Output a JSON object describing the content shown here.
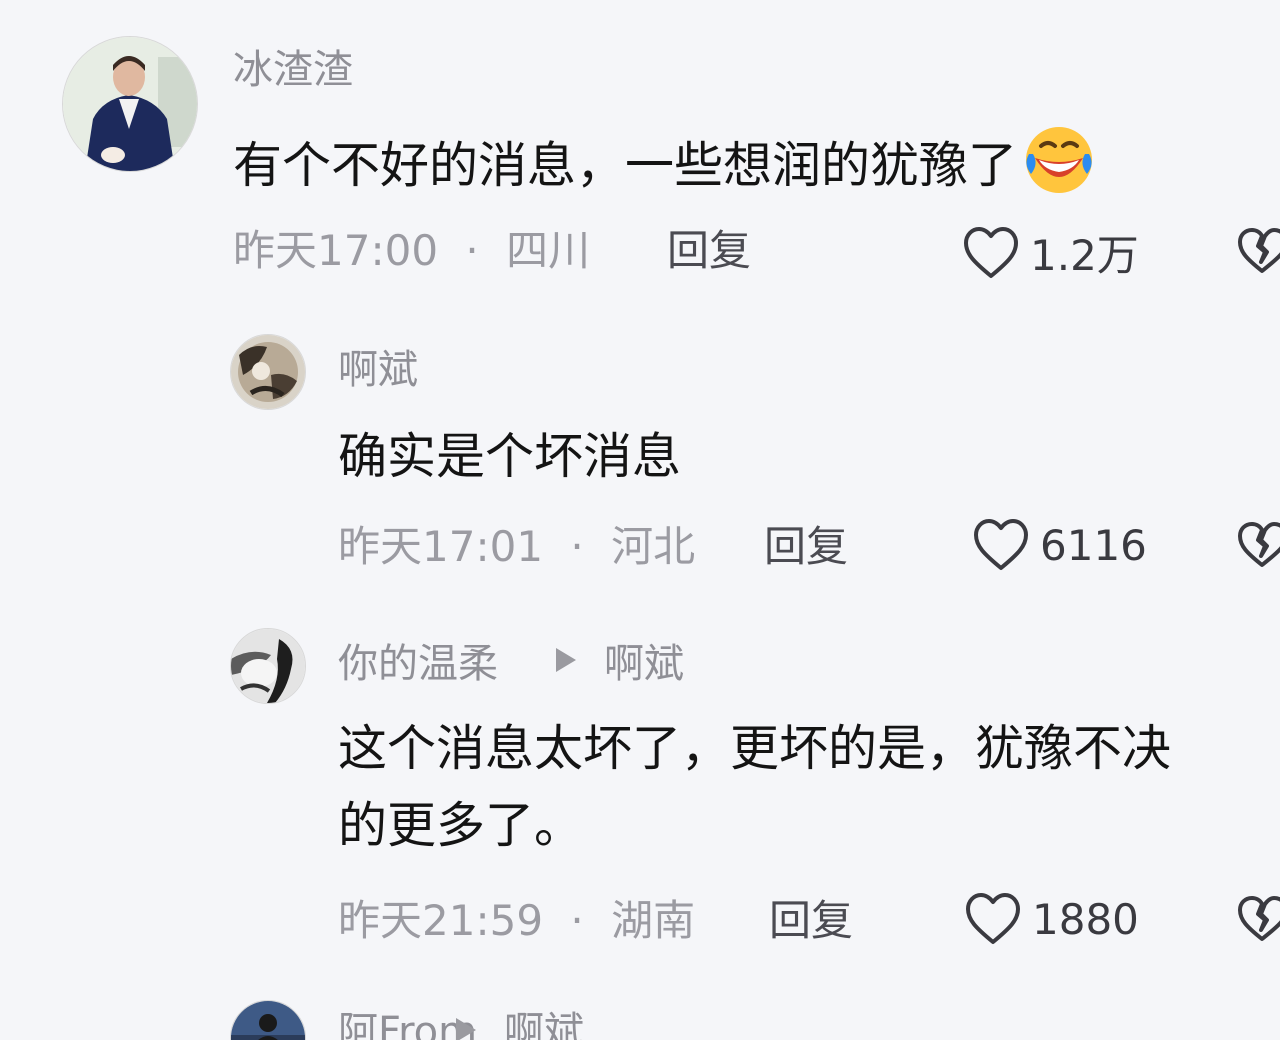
{
  "comments": [
    {
      "user": "冰渣渣",
      "text": "有个不好的消息，一些想润的犹豫了",
      "emoji": "laughing-crying-face-icon",
      "time": "昨天17:00",
      "dot": "·",
      "location": "四川",
      "reply_label": "回复",
      "likes": "1.2万"
    },
    {
      "user": "啊斌",
      "text": "确实是个坏消息",
      "time": "昨天17:01",
      "dot": "·",
      "location": "河北",
      "reply_label": "回复",
      "likes": "6116"
    },
    {
      "user": "你的温柔",
      "reply_to": "啊斌",
      "text_line1": "这个消息太坏了，更坏的是，犹豫不决",
      "text_line2": "的更多了。",
      "time": "昨天21:59",
      "dot": "·",
      "location": "湖南",
      "reply_label": "回复",
      "likes": "1880"
    },
    {
      "user": "阿From",
      "reply_to": "啊斌"
    }
  ],
  "colors": {
    "background": "#f5f6f9",
    "text": "#141414",
    "meta": "#9b9ba2",
    "username": "#8f8f96"
  },
  "icons": {
    "like": "heart-outline-icon",
    "dislike": "broken-heart-icon",
    "reply_indicator": "play-triangle-icon"
  }
}
